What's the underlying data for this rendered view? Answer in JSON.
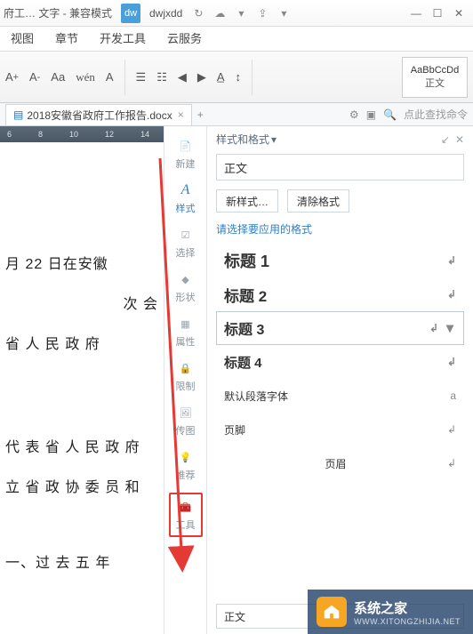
{
  "titlebar": {
    "app_title": "府工… 文字 - 兼容模式",
    "dw_logo": "dw",
    "tab_name": "dwjxdd"
  },
  "menus": [
    "视图",
    "章节",
    "开发工具",
    "云服务"
  ],
  "toolbar": {
    "style_sample": "AaBbCcDd",
    "style_label": "正文"
  },
  "doc_tab": {
    "name": "2018安徽省政府工作报告.docx"
  },
  "tabs_right": {
    "search_hint": "点此查找命令"
  },
  "ruler": [
    "6",
    "8",
    "10",
    "12",
    "14"
  ],
  "doc_lines": [
    "月 22 日在安徽",
    "次 会",
    "省 人 民 政 府",
    "代 表 省 人 民 政 府",
    "立 省 政 协 委 员 和",
    "一、过 去 五 年"
  ],
  "side_toolbar": [
    {
      "label": "新建",
      "icon": "file"
    },
    {
      "label": "样式",
      "icon": "style",
      "active": true
    },
    {
      "label": "选择",
      "icon": "select"
    },
    {
      "label": "形状",
      "icon": "shape"
    },
    {
      "label": "属性",
      "icon": "prop"
    },
    {
      "label": "限制",
      "icon": "limit"
    },
    {
      "label": "传图",
      "icon": "image"
    },
    {
      "label": "推荐",
      "icon": "bulb"
    },
    {
      "label": "工具",
      "icon": "toolbox",
      "boxed": true
    }
  ],
  "style_panel": {
    "title": "样式和格式",
    "current_style": "正文",
    "btn_new": "新样式…",
    "btn_clear": "清除格式",
    "apply_hint": "请选择要应用的格式",
    "items": [
      {
        "label": "标题 1",
        "cls": "h1"
      },
      {
        "label": "标题 2",
        "cls": "h2"
      },
      {
        "label": "标题 3",
        "cls": "h3",
        "selected": true
      },
      {
        "label": "标题 4",
        "cls": "h4"
      },
      {
        "label": "默认段落字体",
        "cls": "small",
        "mark": "a"
      },
      {
        "label": "页脚",
        "cls": "small"
      },
      {
        "label": "页眉",
        "cls": "small",
        "center": true
      }
    ],
    "bottom_select": "正文"
  },
  "watermark": {
    "cn": "系统之家",
    "en": "WWW.XITONGZHIJIA.NET"
  }
}
